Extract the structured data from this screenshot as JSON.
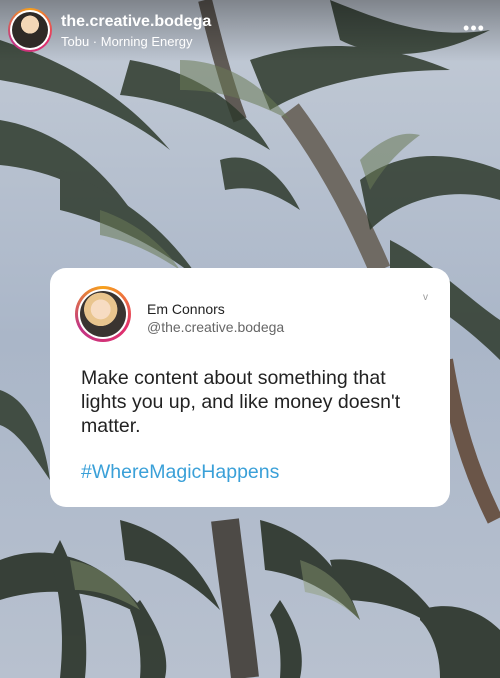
{
  "header": {
    "account_name": "the.creative.bodega",
    "audio": "Tobu · Morning Energy",
    "more_icon": "more-horizontal-icon"
  },
  "card": {
    "author_name": "Em Connors",
    "author_handle": "@the.creative.bodega",
    "text": "Make content about something that lights you up, and like money doesn't matter.",
    "hashtag": "#WhereMagicHappens",
    "chevron": "v"
  },
  "colors": {
    "hashtag": "#3aa0d8",
    "sky": "#a9b8cc",
    "card_bg": "#ffffff"
  }
}
